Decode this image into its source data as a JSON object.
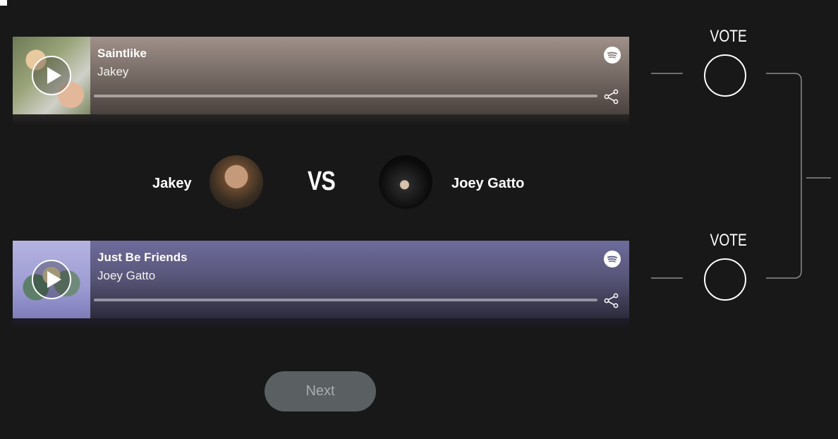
{
  "matchup": {
    "track1": {
      "title": "Saintlike",
      "artist": "Jakey"
    },
    "track2": {
      "title": "Just Be Friends",
      "artist": "Joey Gatto"
    },
    "versus": {
      "left_name": "Jakey",
      "vs_label": "VS",
      "right_name": "Joey Gatto"
    }
  },
  "vote": {
    "label1": "VOTE",
    "label2": "VOTE"
  },
  "actions": {
    "next_label": "Next"
  },
  "icons": {
    "play": "play-icon",
    "spotify": "spotify-icon",
    "share": "share-icon"
  },
  "colors": {
    "background": "#181818",
    "track1_tint": "#8c7f78",
    "track2_tint": "#5e5c86",
    "next_bg": "#5a5f62"
  }
}
